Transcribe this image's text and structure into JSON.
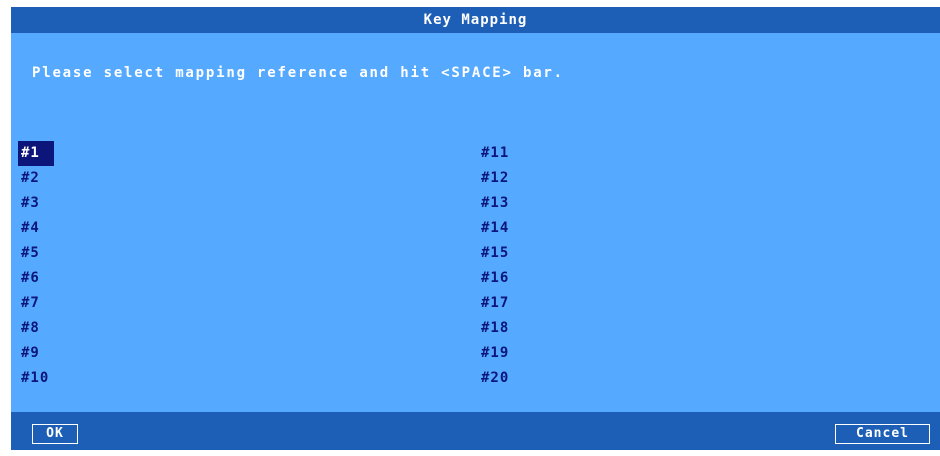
{
  "dialog": {
    "title": "Key Mapping",
    "message": "Please select mapping reference and hit <SPACE> bar."
  },
  "mappings": {
    "left": [
      "#1",
      "#2",
      "#3",
      "#4",
      "#5",
      "#6",
      "#7",
      "#8",
      "#9",
      "#10"
    ],
    "right": [
      "#11",
      "#12",
      "#13",
      "#14",
      "#15",
      "#16",
      "#17",
      "#18",
      "#19",
      "#20"
    ],
    "selected": "#1"
  },
  "buttons": {
    "ok_label": "OK",
    "cancel_label": "Cancel"
  },
  "colors": {
    "background": "#55aaff",
    "titlebar": "#1d5fb6",
    "item_text": "#0b157a",
    "selected_bg": "#0b157a"
  }
}
